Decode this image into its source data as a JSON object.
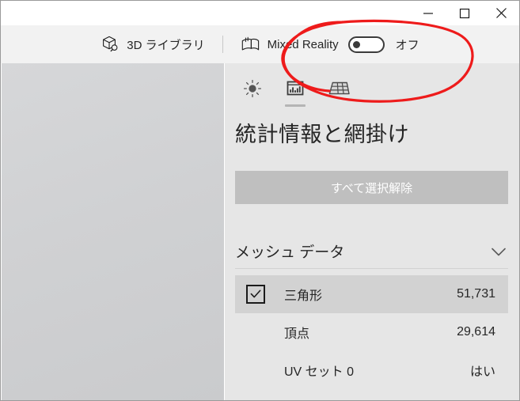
{
  "window": {
    "caption_buttons": [
      {
        "name": "minimize",
        "glyph": "minimize-icon",
        "title": "最小化"
      },
      {
        "name": "maximize",
        "glyph": "maximize-icon",
        "title": "最大化"
      },
      {
        "name": "close",
        "glyph": "close-icon",
        "title": "閉じる"
      }
    ]
  },
  "commandbar": {
    "library": {
      "icon": "3d-cube-search-icon",
      "label": "3D ライブラリ"
    },
    "mixed_reality": {
      "icon": "mixed-reality-icon",
      "label": "Mixed Reality",
      "toggle_state": "off",
      "toggle_label": "オフ"
    }
  },
  "panel": {
    "tabs": [
      {
        "id": "lighting",
        "icon": "sun-brightness-icon",
        "selected": false
      },
      {
        "id": "statistics",
        "icon": "bar-chart-statistics-icon",
        "selected": true
      },
      {
        "id": "mesh-grid",
        "icon": "grid-mesh-icon",
        "selected": false
      }
    ],
    "title": "統計情報と網掛け",
    "deselect_button": "すべて選択解除",
    "mesh_section": {
      "header": "メッシュ データ",
      "chevron": "chevron-down-icon",
      "rows": [
        {
          "label": "三角形",
          "value": "51,731",
          "checkbox": "checked",
          "selected": true
        },
        {
          "label": "頂点",
          "value": "29,614",
          "checkbox": "none",
          "selected": false
        },
        {
          "label": "UV セット 0",
          "value": "はい",
          "checkbox": "none",
          "selected": false
        }
      ]
    }
  },
  "annotation": {
    "type": "hand-drawn-ellipse",
    "color": "#ee1b1b",
    "target": "Mixed Reality toggle"
  },
  "colors": {
    "titlebar_bg": "#ffffff",
    "commandbar_bg": "#f2f2f2",
    "panel_bg": "#e6e6e6",
    "viewport_bg": "#d1d2d4",
    "button_bg": "#bfbfbf",
    "row_selected_bg": "#d2d2d2",
    "text": "#262626",
    "annotation_red": "#ee1b1b"
  }
}
